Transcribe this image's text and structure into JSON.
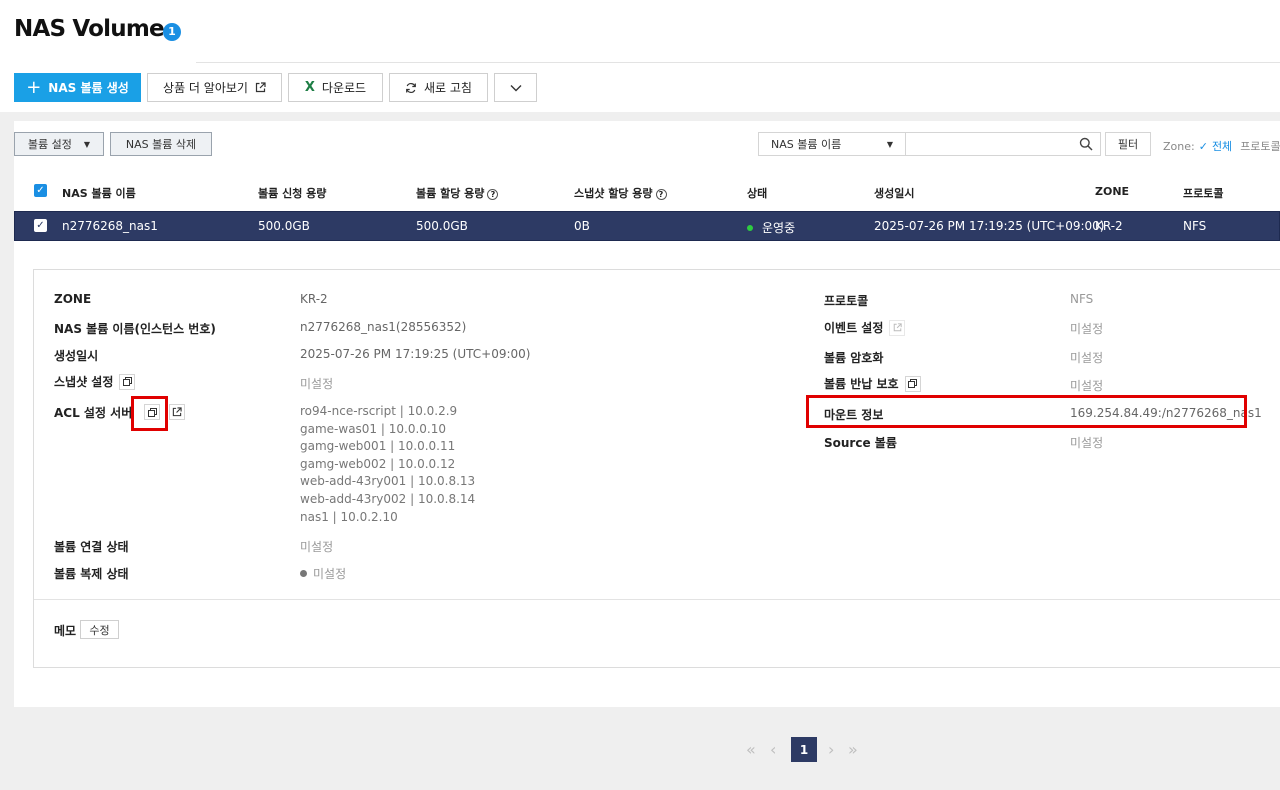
{
  "page": {
    "title": "NAS Volume",
    "count_badge": "1"
  },
  "toolbar": {
    "create_label": "NAS 볼륨 생성",
    "learn_more_label": "상품 더 알아보기",
    "download_label": "다운로드",
    "refresh_label": "새로 고침"
  },
  "actions": {
    "volume_settings_label": "볼륨 설정",
    "delete_label": "NAS 볼륨 삭제"
  },
  "filter": {
    "selected_field": "NAS 볼륨 이름",
    "search_value": "",
    "filter_label": "필터",
    "zone_label": "Zone:",
    "zone_value": "전체",
    "protocol_label": "프로토콜"
  },
  "table": {
    "headers": [
      "NAS 볼륨 이름",
      "볼륨 신청 용량",
      "볼륨 할당 용량",
      "스냅샷 할당 용량",
      "상태",
      "생성일시",
      "ZONE",
      "프로토콜"
    ],
    "row": {
      "name": "n2776268_nas1",
      "requested": "500.0GB",
      "allocated": "500.0GB",
      "snapshot": "0B",
      "status": "운영중",
      "created": "2025-07-26 PM 17:19:25 (UTC+09:00)",
      "zone": "KR-2",
      "protocol": "NFS"
    }
  },
  "details": {
    "zone": {
      "label": "ZONE",
      "value": "KR-2"
    },
    "name_instance": {
      "label": "NAS 볼륨 이름(인스턴스 번호)",
      "value": "n2776268_nas1(28556352)"
    },
    "created": {
      "label": "생성일시",
      "value": "2025-07-26 PM 17:19:25 (UTC+09:00)"
    },
    "snapshot": {
      "label": "스냅샷 설정",
      "value": "미설정"
    },
    "acl": {
      "label": "ACL 설정 서버",
      "servers": [
        "ro94-nce-rscript | 10.0.2.9",
        "game-was01 | 10.0.0.10",
        "gamg-web001 | 10.0.0.11",
        "gamg-web002 | 10.0.0.12",
        "web-add-43ry001 | 10.0.8.13",
        "web-add-43ry002 | 10.0.8.14",
        "nas1 | 10.0.2.10"
      ]
    },
    "connection": {
      "label": "볼륨 연결 상태",
      "value": "미설정"
    },
    "replication": {
      "label": "볼륨 복제 상태",
      "value": "미설정"
    },
    "protocol": {
      "label": "프로토콜",
      "value": "NFS"
    },
    "event": {
      "label": "이벤트 설정",
      "value": "미설정"
    },
    "encryption": {
      "label": "볼륨 암호화",
      "value": "미설정"
    },
    "return_protection": {
      "label": "볼륨 반납 보호",
      "value": "미설정"
    },
    "mount": {
      "label": "마운트 정보",
      "value": "169.254.84.49:/n2776268_nas1"
    },
    "source": {
      "label": "Source 볼륨",
      "value": "미설정"
    },
    "memo": {
      "label": "메모",
      "edit_label": "수정"
    }
  },
  "pagination": {
    "current": "1"
  },
  "colors": {
    "accent": "#1aa0e6",
    "selected_row": "#2d3a64",
    "highlight": "#e00000",
    "status_ok": "#2ecc40"
  }
}
